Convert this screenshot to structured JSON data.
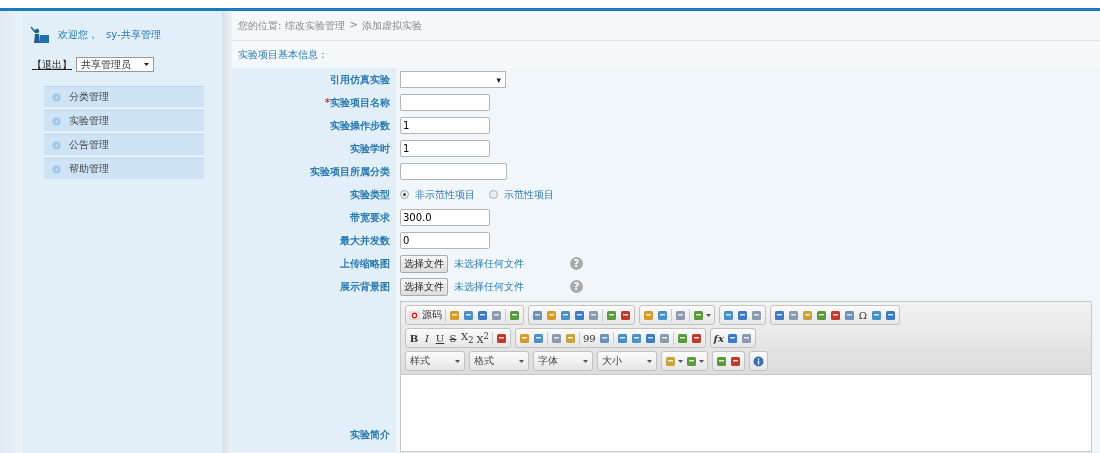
{
  "sidebar": {
    "welcome": "欢迎您，",
    "user": "sy-共享管理",
    "logout": "【退出】",
    "role_select": "共享管理员",
    "menu": [
      {
        "label": "分类管理"
      },
      {
        "label": "实验管理"
      },
      {
        "label": "公告管理"
      },
      {
        "label": "帮助管理"
      }
    ]
  },
  "breadcrumb": {
    "prefix": "您的位置:",
    "path": [
      "综改实验管理",
      "添加虚拟实验"
    ],
    "separator": ">"
  },
  "section_title": "实验项目基本信息：",
  "form": [
    {
      "kind": "select",
      "label": "引用仿真实验",
      "caret": "▾"
    },
    {
      "kind": "text",
      "label": "实验项目名称",
      "required": true,
      "required_mark": "*"
    },
    {
      "kind": "text",
      "label": "实验操作步数",
      "value": "1"
    },
    {
      "kind": "text",
      "label": "实验学时",
      "value": "1"
    },
    {
      "kind": "text",
      "label": "实验项目所属分类",
      "wide": true
    },
    {
      "kind": "radio",
      "label": "实验类型",
      "options": [
        {
          "label": "非示范性项目",
          "selected": true
        },
        {
          "label": "示范性项目",
          "selected": false
        }
      ]
    },
    {
      "kind": "text",
      "label": "带宽要求",
      "value": "300.0"
    },
    {
      "kind": "text",
      "label": "最大并发数",
      "value": "0"
    },
    {
      "kind": "file",
      "label": "上传缩略图",
      "button": "选择文件",
      "status": "未选择任何文件",
      "help": "?"
    },
    {
      "kind": "file",
      "label": "展示背景图",
      "button": "选择文件",
      "status": "未选择任何文件",
      "help": "?"
    },
    {
      "kind": "editor",
      "label": "实验简介"
    }
  ],
  "editor": {
    "rows": [
      [
        [
          {
            "kind": "source",
            "label": "源码"
          },
          {
            "kind": "sep"
          },
          {
            "kind": "icon"
          },
          {
            "kind": "icon"
          },
          {
            "kind": "icon"
          },
          {
            "kind": "icon"
          },
          {
            "kind": "sep"
          },
          {
            "kind": "icon"
          }
        ],
        [
          {
            "kind": "icon"
          },
          {
            "kind": "icon"
          },
          {
            "kind": "icon"
          },
          {
            "kind": "icon"
          },
          {
            "kind": "icon"
          },
          {
            "kind": "sep"
          },
          {
            "kind": "icon"
          },
          {
            "kind": "icon"
          }
        ],
        [
          {
            "kind": "icon"
          },
          {
            "kind": "icon"
          },
          {
            "kind": "sep"
          },
          {
            "kind": "icon"
          },
          {
            "kind": "sep"
          },
          {
            "kind": "icon-dropdown"
          }
        ],
        [
          {
            "kind": "icon"
          },
          {
            "kind": "icon"
          },
          {
            "kind": "icon"
          }
        ],
        [
          {
            "kind": "icon"
          },
          {
            "kind": "icon"
          },
          {
            "kind": "icon"
          },
          {
            "kind": "icon"
          },
          {
            "kind": "icon"
          },
          {
            "kind": "icon"
          },
          {
            "kind": "glyph",
            "label": "Ω"
          },
          {
            "kind": "icon"
          },
          {
            "kind": "icon"
          }
        ]
      ],
      [
        [
          {
            "kind": "glyph",
            "label": "B",
            "bold": true
          },
          {
            "kind": "glyph",
            "label": "I",
            "italic": true
          },
          {
            "kind": "glyph",
            "label": "U",
            "underline": true
          },
          {
            "kind": "glyph",
            "label": "S",
            "strike": true
          },
          {
            "kind": "glyph",
            "label": "X$_{2}$"
          },
          {
            "kind": "glyph",
            "label": "X$^{2}$"
          },
          {
            "kind": "sep"
          },
          {
            "kind": "icon"
          }
        ],
        [
          {
            "kind": "icon"
          },
          {
            "kind": "icon"
          },
          {
            "kind": "sep"
          },
          {
            "kind": "icon"
          },
          {
            "kind": "icon"
          },
          {
            "kind": "sep"
          },
          {
            "kind": "glyph",
            "label": "99"
          },
          {
            "kind": "icon"
          },
          {
            "kind": "sep"
          },
          {
            "kind": "icon"
          },
          {
            "kind": "icon"
          },
          {
            "kind": "icon"
          },
          {
            "kind": "icon"
          },
          {
            "kind": "sep"
          },
          {
            "kind": "icon"
          },
          {
            "kind": "icon"
          }
        ],
        [
          {
            "kind": "glyph",
            "label": "fx",
            "italic": true,
            "bold": true
          },
          {
            "kind": "icon"
          },
          {
            "kind": "icon"
          }
        ]
      ],
      [
        [
          {
            "kind": "dropdown",
            "label": "样式"
          }
        ],
        [
          {
            "kind": "dropdown",
            "label": "格式"
          }
        ],
        [
          {
            "kind": "dropdown",
            "label": "字体"
          }
        ],
        [
          {
            "kind": "dropdown",
            "label": "大小"
          }
        ],
        [
          {
            "kind": "icon-dropdown"
          },
          {
            "kind": "icon-dropdown"
          }
        ],
        [
          {
            "kind": "icon"
          },
          {
            "kind": "icon"
          }
        ],
        [
          {
            "kind": "info"
          }
        ]
      ]
    ]
  }
}
